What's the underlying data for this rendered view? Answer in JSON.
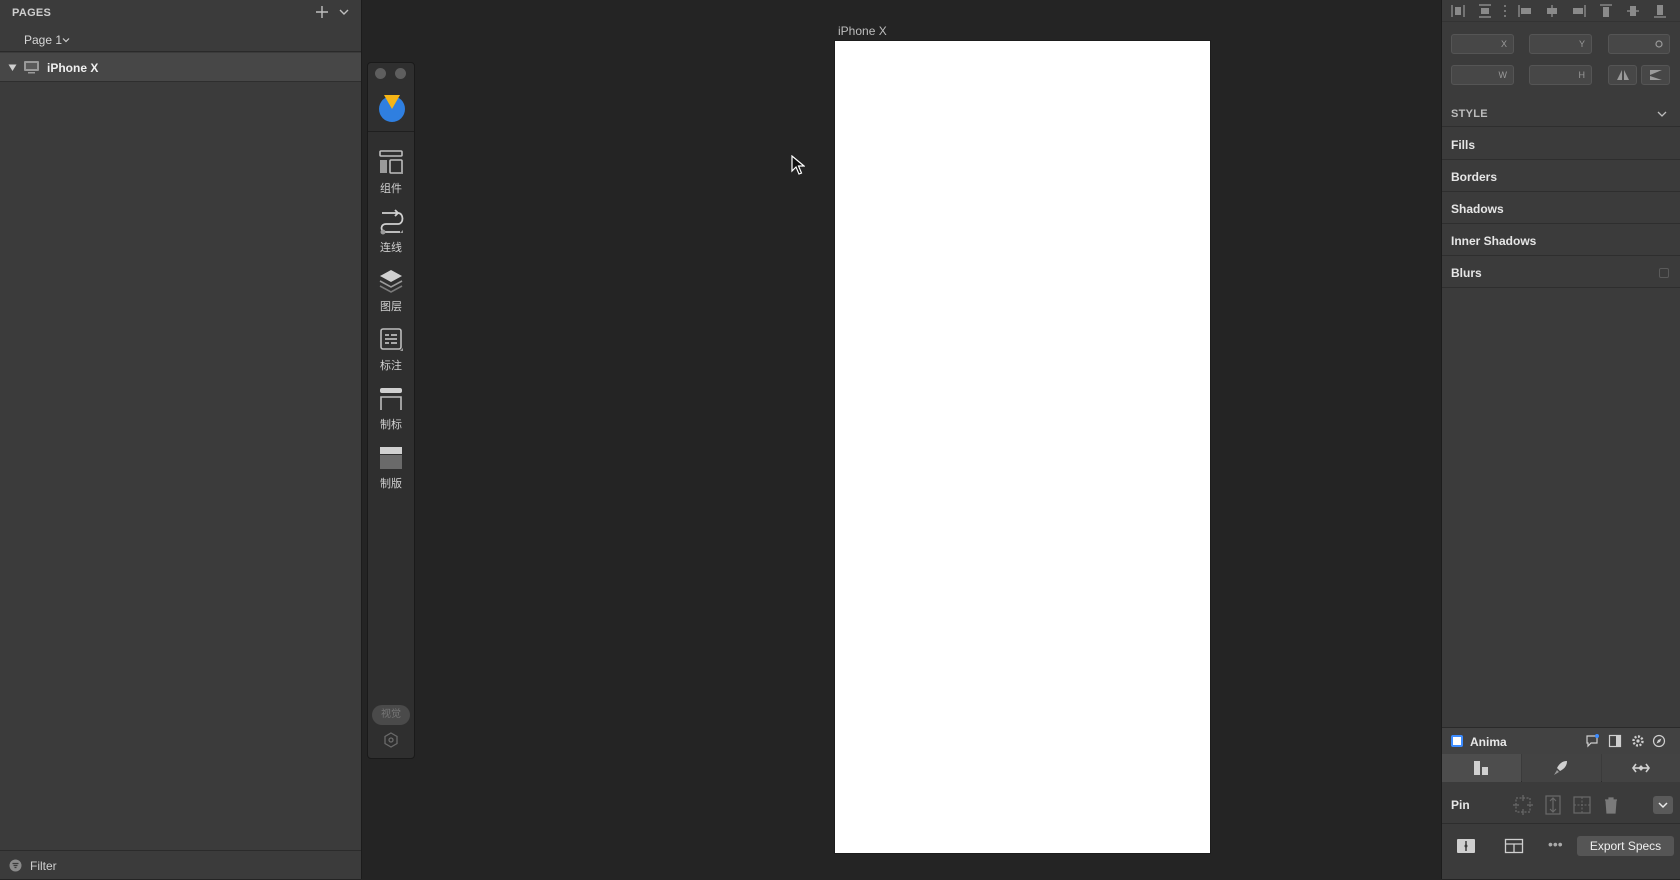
{
  "left_panel": {
    "pages_title": "PAGES",
    "current_page": "Page 1",
    "layers": [
      {
        "name": "iPhone X",
        "type": "artboard",
        "expanded": true
      }
    ],
    "filter_label": "Filter"
  },
  "plugin_toolbar": {
    "tools": [
      {
        "label": "组件",
        "icon": "components-icon"
      },
      {
        "label": "连线",
        "icon": "flow-link-icon"
      },
      {
        "label": "图层",
        "icon": "layers-icon"
      },
      {
        "label": "标注",
        "icon": "annotation-icon"
      },
      {
        "label": "制标",
        "icon": "markup-icon"
      },
      {
        "label": "制版",
        "icon": "slicing-icon"
      }
    ],
    "visual_button": "视觉",
    "accent_colors": {
      "logo_top": "#f5b516",
      "logo_bottom": "#2f7fe0"
    }
  },
  "canvas": {
    "artboard_title": "iPhone X",
    "artboard_color": "#ffffff",
    "background": "#242424"
  },
  "inspector": {
    "fields": {
      "x": "X",
      "y": "Y",
      "w": "W",
      "h": "H"
    },
    "style_title": "STYLE",
    "style_rows": {
      "fills": "Fills",
      "borders": "Borders",
      "shadows": "Shadows",
      "inner_shadows": "Inner Shadows",
      "blurs": "Blurs"
    },
    "anima": {
      "title": "Anima",
      "pin_label": "Pin",
      "export_button": "Export Specs",
      "more": "•••"
    }
  }
}
